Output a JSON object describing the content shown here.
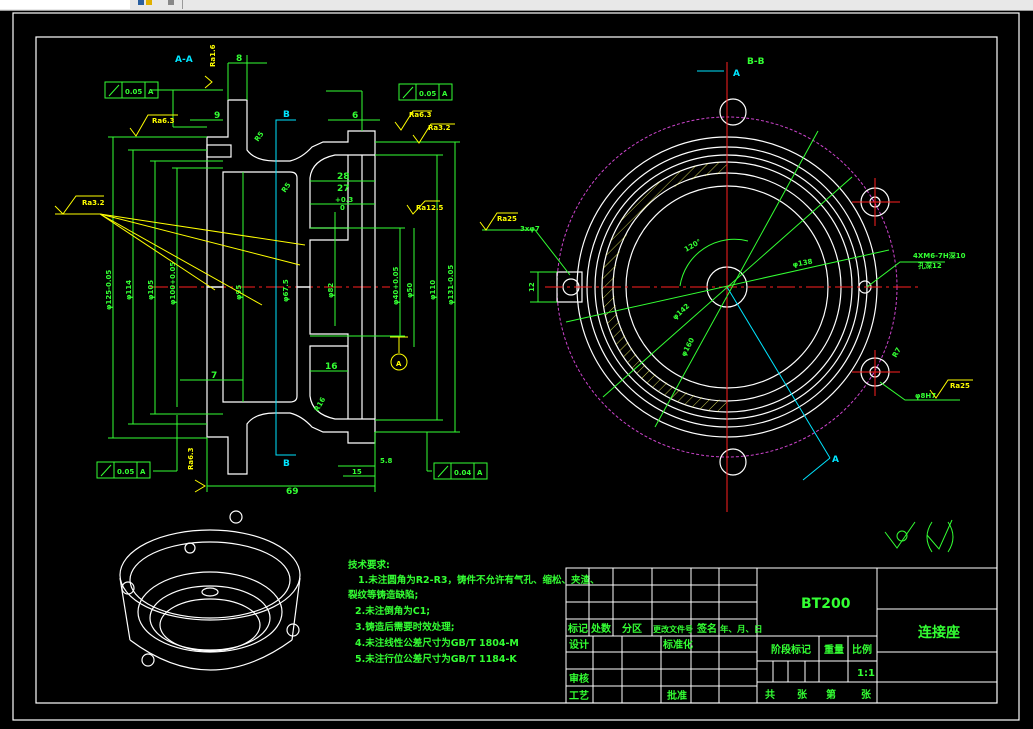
{
  "colors": {
    "background": "#000000",
    "outline": "#ffffff",
    "dimension": "#33ff33",
    "roughness": "#ffff00",
    "section_marker": "#00e5ff",
    "centerline": "#ff2020",
    "phantom": "#cc44cc"
  },
  "section_view": {
    "title": "A-A",
    "cut_marker_top": "B",
    "cut_marker_bottom": "B",
    "tolerance_frames": [
      {
        "symbol": "runout-arrow",
        "value": "0.05",
        "datum": "A"
      },
      {
        "symbol": "runout-arrow",
        "value": "0.05",
        "datum": "A"
      },
      {
        "symbol": "runout-arrow",
        "value": "0.05",
        "datum": "A"
      },
      {
        "symbol": "runout-arrow",
        "value": "0.04",
        "datum": "A"
      }
    ],
    "roughness": [
      "Ra6.3",
      "Ra3.2",
      "Ra6.3",
      "Ra3.2",
      "Ra1.6",
      "Ra12.5",
      "Ra6.3"
    ],
    "dims": {
      "d8": "8",
      "d9": "9",
      "d6": "6",
      "r25": "R5",
      "r26": "R5",
      "d28": "28",
      "d27": "27",
      "tol": "+0.3",
      "tol0": "0",
      "phi125": "φ125-0.05",
      "phi114": "φ114",
      "phi105": "φ105",
      "phi100": "φ100+0.05",
      "phi95": "φ95",
      "phi675": "φ67.5",
      "phi82": "φ82",
      "phi40": "φ40+0.05",
      "phi50": "φ50",
      "phi110": "φ110",
      "phi131": "φ131-0.05",
      "d7": "7",
      "d16": "16",
      "r16": "R16",
      "d58": "5.8",
      "d15": "15",
      "d69": "69"
    },
    "datum": "A"
  },
  "circle_view": {
    "title": "B-B",
    "marker_top": "A",
    "marker_bottom": "A",
    "angle": "120°",
    "phi138": "φ138",
    "phi142": "φ142",
    "phi160": "φ160",
    "holes": "3xφ7",
    "hole_ra": "Ra25",
    "tapped": "4XM6-7H深10",
    "tapped2": "孔深12",
    "r7": "R7",
    "d12": "12",
    "rb": "φ8H7",
    "rb_ra": "Ra25"
  },
  "iso_view": {},
  "tech_requirements": {
    "heading": "技术要求:",
    "lines": [
      "1.未注圆角为R2-R3，铸件不允许有气孔、缩松、夹渣、",
      "裂纹等铸造缺陷;",
      "2.未注倒角为C1;",
      "3.铸造后需要时效处理;",
      "4.未注线性公差尺寸为GB/T 1804-M",
      "5.未注行位公差尺寸为GB/T 1184-K"
    ]
  },
  "surface_symbol": {
    "left": "√",
    "right": "(√)"
  },
  "title_block": {
    "material": "BT200",
    "part_name": "连接座",
    "rev_headers": [
      "标记",
      "处数",
      "分区",
      "更改文件号",
      "签名",
      "年、月、日"
    ],
    "design": "设计",
    "standardization": "标准化",
    "review": "审核",
    "process": "工艺",
    "approve": "批准",
    "stage": "阶段标记",
    "weight": "重量",
    "scale_label": "比例",
    "scale": "1:1",
    "sheets": [
      "共",
      "张",
      "第",
      "张"
    ]
  }
}
